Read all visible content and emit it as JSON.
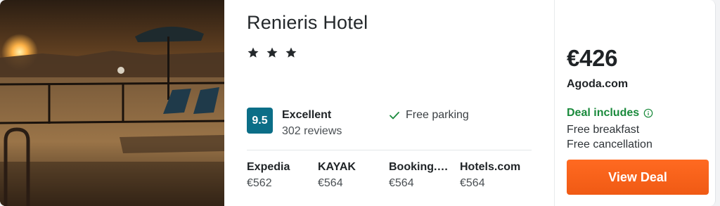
{
  "hotel": {
    "name": "Renieris Hotel",
    "star_count": 3,
    "photo_alt": "Hotel photo"
  },
  "rating": {
    "score": "9.5",
    "label": "Excellent",
    "reviews": "302 reviews"
  },
  "amenity": {
    "label": "Free parking"
  },
  "providers": [
    {
      "name": "Expedia",
      "price": "€562"
    },
    {
      "name": "KAYAK",
      "price": "€564"
    },
    {
      "name": "Booking.…",
      "price": "€564"
    },
    {
      "name": "Hotels.com",
      "price": "€564"
    }
  ],
  "deal": {
    "price": "€426",
    "provider": "Agoda.com",
    "includes_label": "Deal includes",
    "features": [
      "Free breakfast",
      "Free cancellation"
    ],
    "button_label": "View Deal"
  },
  "colors": {
    "rating_badge": "#0b6e87",
    "deal_includes": "#1a8a3c",
    "button": "#f05a14"
  }
}
